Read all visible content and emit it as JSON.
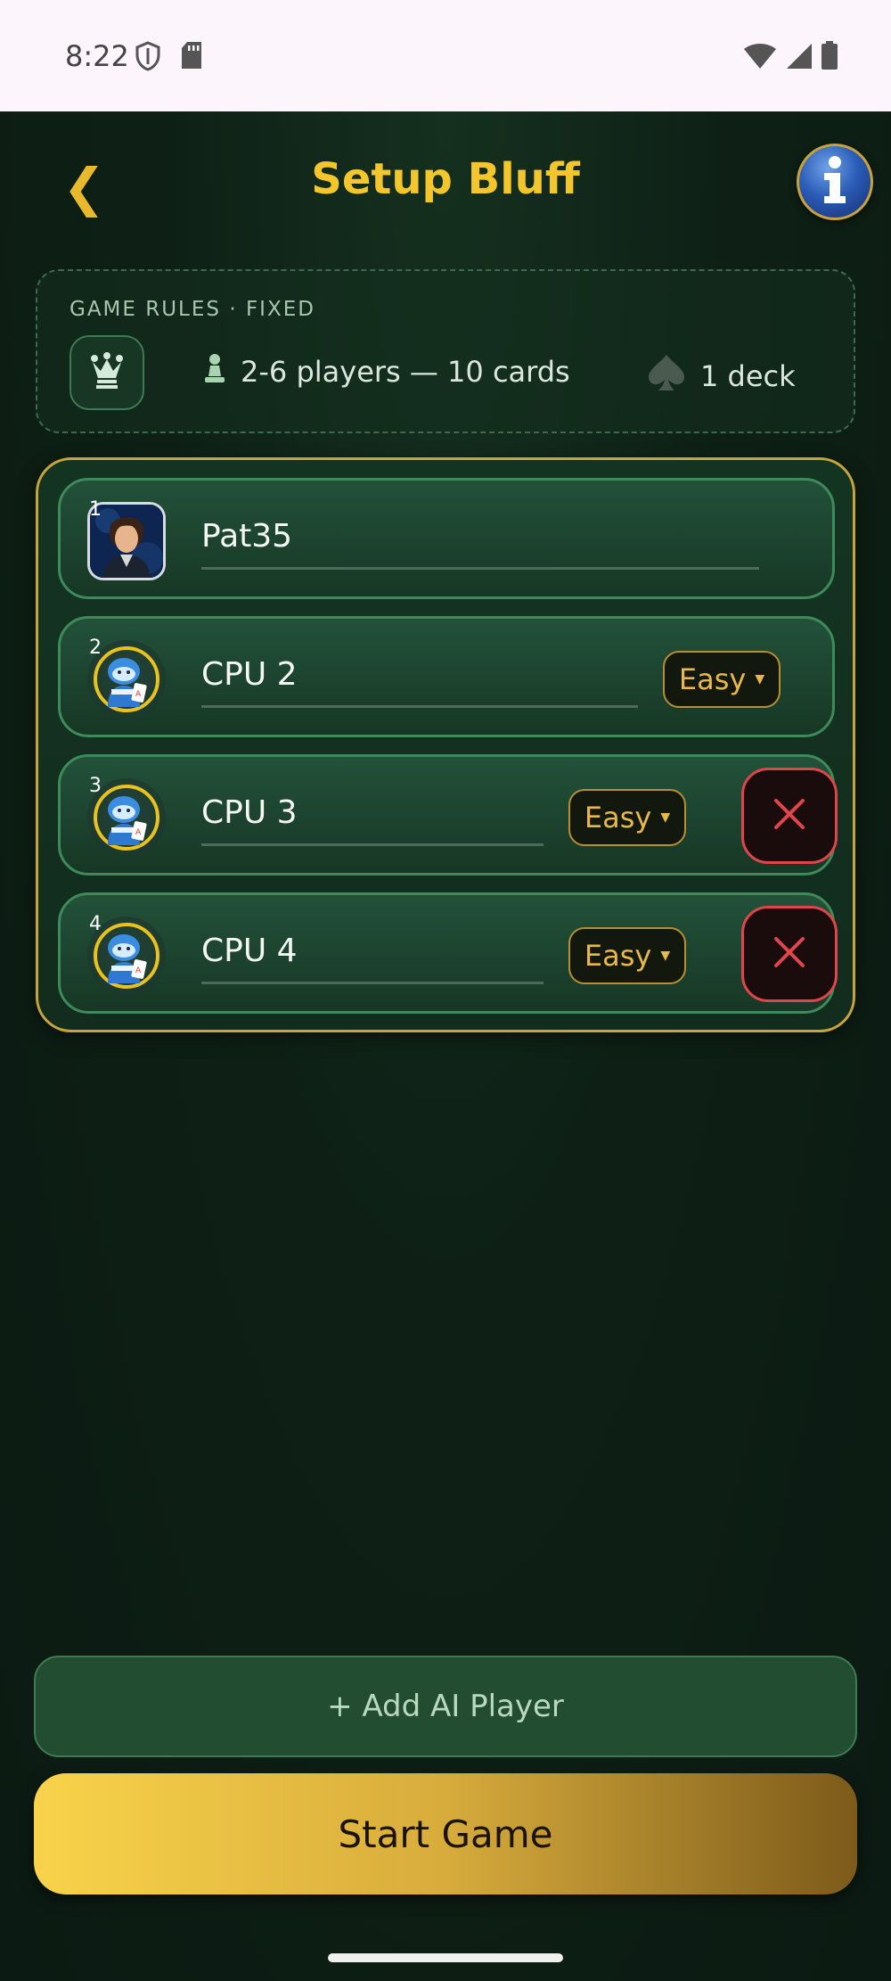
{
  "status_bar": {
    "time": "8:22"
  },
  "header": {
    "title": "Setup Bluff",
    "back_glyph": "❮",
    "info_icon": "info-icon"
  },
  "rules": {
    "heading": "GAME RULES · FIXED",
    "players": "2-6 players — 10 cards",
    "deck": "1 deck"
  },
  "players": [
    {
      "number": "1",
      "name": "Pat35",
      "type": "human"
    },
    {
      "number": "2",
      "name": "CPU 2",
      "type": "cpu",
      "difficulty": "Easy",
      "removable": false
    },
    {
      "number": "3",
      "name": "CPU 3",
      "type": "cpu",
      "difficulty": "Easy",
      "removable": true
    },
    {
      "number": "4",
      "name": "CPU 4",
      "type": "cpu",
      "difficulty": "Easy",
      "removable": true
    }
  ],
  "actions": {
    "add_ai": "+ Add AI Player",
    "start": "Start Game"
  },
  "colors": {
    "accent_gold": "#f3c62c",
    "panel_border": "#c8a53c",
    "row_border": "#3d8a5a",
    "remove_red": "#e0454b"
  }
}
